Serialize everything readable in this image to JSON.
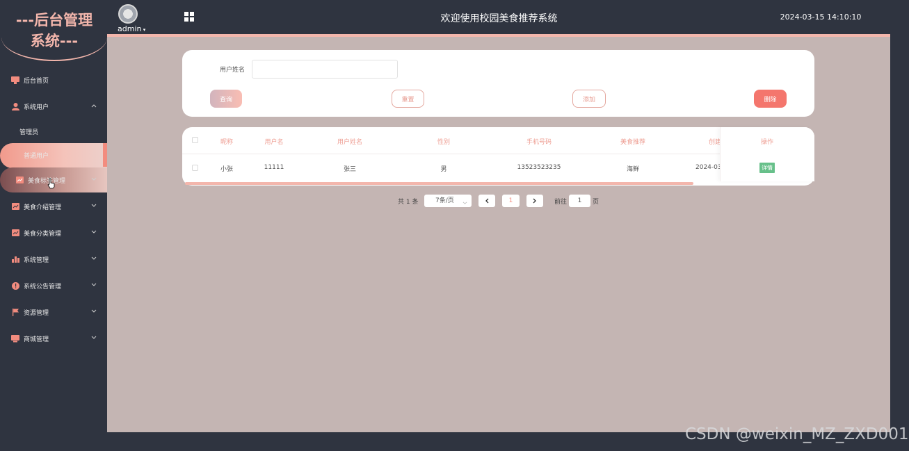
{
  "sidebar": {
    "logo_line1": "---后台管理",
    "logo_line2": "系统---",
    "items": [
      {
        "label": "后台首页",
        "icon": "monitor-icon"
      },
      {
        "label": "系统用户",
        "icon": "user-icon"
      },
      {
        "label": "管理员"
      },
      {
        "label": "普通用户"
      },
      {
        "label": "美食标签管理",
        "icon": "chart-icon"
      },
      {
        "label": "美食介绍管理",
        "icon": "chart-icon"
      },
      {
        "label": "美食分类管理",
        "icon": "chart-icon"
      },
      {
        "label": "系统管理",
        "icon": "bar-chart-icon"
      },
      {
        "label": "系统公告管理",
        "icon": "info-icon"
      },
      {
        "label": "资源管理",
        "icon": "flag-icon"
      },
      {
        "label": "商城管理",
        "icon": "monitor-icon"
      }
    ]
  },
  "header": {
    "username": "admin",
    "title": "欢迎使用校园美食推荐系统",
    "datetime": "2024-03-15 14:10:10"
  },
  "search": {
    "label": "用户姓名",
    "value": "",
    "query_label": "查询",
    "reset_label": "重置",
    "add_label": "添加",
    "delete_label": "删除"
  },
  "table": {
    "columns": [
      "昵称",
      "用户名",
      "用户姓名",
      "性别",
      "手机号码",
      "美食推荐",
      "创建",
      "操作"
    ],
    "rows": [
      {
        "nickname": "小张",
        "username": "11111",
        "realname": "张三",
        "gender": "男",
        "phone": "13523523235",
        "food": "海鲜",
        "created": "2024-03",
        "action": "详情"
      }
    ]
  },
  "pagination": {
    "total": "共 1 条",
    "page_size": "7条/页",
    "current": "1",
    "goto_label": "前往",
    "goto_value": "1",
    "page_suffix": "页"
  },
  "watermark": "CSDN @weixin_MZ_ZXD001",
  "colors": {
    "sidebar_bg": "#2f3440",
    "accent": "#f3b6ac",
    "main_bg": "#c4b5b3",
    "delete": "#f4766d",
    "detail": "#67c08a"
  }
}
